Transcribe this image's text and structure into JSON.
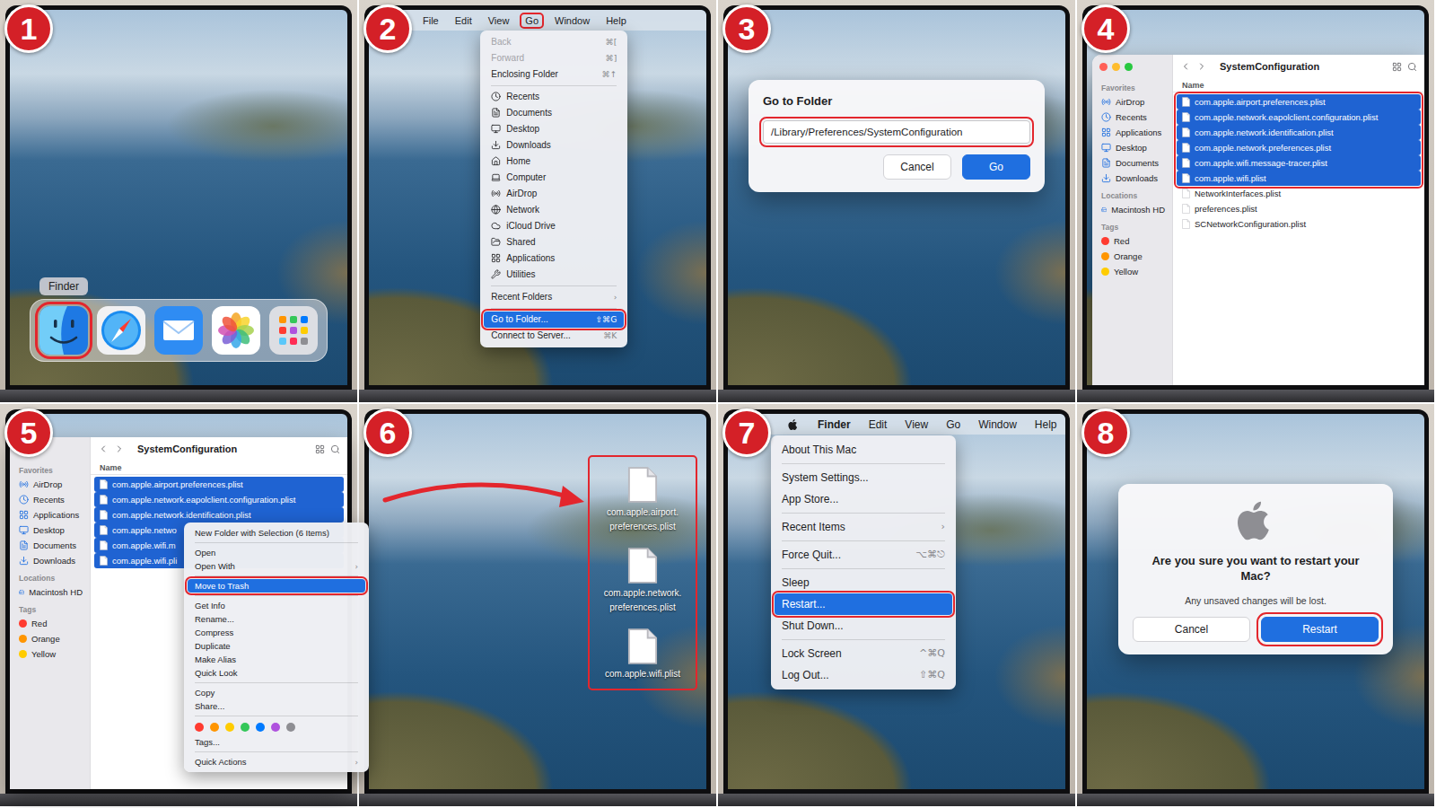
{
  "panels": [
    {
      "number": "1",
      "kind": "dock",
      "tooltip": "Finder",
      "dock_items": [
        {
          "kind": "finder",
          "selected": true
        },
        {
          "kind": "safari",
          "selected": false
        },
        {
          "kind": "mail",
          "selected": false
        },
        {
          "kind": "photos",
          "selected": false
        },
        {
          "kind": "launchpad",
          "selected": false
        }
      ]
    },
    {
      "number": "2",
      "kind": "go-menu",
      "menu_bar": [
        {
          "label": "File",
          "bold": false,
          "selected": false
        },
        {
          "label": "Edit",
          "bold": false,
          "selected": false
        },
        {
          "label": "View",
          "bold": false,
          "selected": false
        },
        {
          "label": "Go",
          "bold": false,
          "selected": true
        },
        {
          "label": "Window",
          "bold": false,
          "selected": false
        },
        {
          "label": "Help",
          "bold": false,
          "selected": false
        }
      ],
      "menu": [
        {
          "kind": "item",
          "label": "Back",
          "shortcut": "⌘[",
          "disabled": true,
          "selected": false
        },
        {
          "kind": "item",
          "label": "Forward",
          "shortcut": "⌘]",
          "disabled": true,
          "selected": false
        },
        {
          "kind": "item",
          "label": "Enclosing Folder",
          "shortcut": "⌘↑",
          "disabled": false,
          "selected": false
        },
        {
          "kind": "separator"
        },
        {
          "kind": "place",
          "label": "Recents",
          "disabled": false,
          "selected": false
        },
        {
          "kind": "place",
          "label": "Documents",
          "disabled": false,
          "selected": false
        },
        {
          "kind": "place",
          "label": "Desktop",
          "disabled": false,
          "selected": false
        },
        {
          "kind": "place",
          "label": "Downloads",
          "disabled": false,
          "selected": false
        },
        {
          "kind": "place",
          "label": "Home",
          "disabled": false,
          "selected": false
        },
        {
          "kind": "place",
          "label": "Computer",
          "disabled": false,
          "selected": false
        },
        {
          "kind": "place",
          "label": "AirDrop",
          "disabled": false,
          "selected": false
        },
        {
          "kind": "place",
          "label": "Network",
          "disabled": false,
          "selected": false
        },
        {
          "kind": "place",
          "label": "iCloud Drive",
          "disabled": false,
          "selected": false
        },
        {
          "kind": "place",
          "label": "Shared",
          "disabled": false,
          "selected": false
        },
        {
          "kind": "place",
          "label": "Applications",
          "disabled": false,
          "selected": false
        },
        {
          "kind": "place",
          "label": "Utilities",
          "disabled": false,
          "selected": false
        },
        {
          "kind": "separator"
        },
        {
          "kind": "submenu",
          "label": "Recent Folders",
          "arrow": "›",
          "disabled": false,
          "selected": false
        },
        {
          "kind": "separator"
        },
        {
          "kind": "item",
          "label": "Go to Folder...",
          "shortcut": "⇧⌘G",
          "disabled": false,
          "selected": true
        },
        {
          "kind": "item",
          "label": "Connect to Server...",
          "shortcut": "⌘K",
          "disabled": false,
          "selected": false
        }
      ]
    },
    {
      "number": "3",
      "kind": "go-dialog",
      "dialog": {
        "title": "Go to Folder",
        "path": "/Library/Preferences/SystemConfiguration",
        "field_highlighted": true,
        "buttons": [
          {
            "label": "Cancel",
            "selected": false,
            "highlighted": false
          },
          {
            "label": "Go",
            "selected": true,
            "highlighted": false
          }
        ]
      }
    },
    {
      "number": "4",
      "kind": "finder",
      "window": {
        "title": "SystemConfiguration",
        "show_controls": true,
        "selection_boxed": true,
        "column": "Name",
        "sidebar": [
          {
            "heading": "Favorites",
            "items": [
              {
                "label": "AirDrop",
                "kind": "place"
              },
              {
                "label": "Recents",
                "kind": "place"
              },
              {
                "label": "Applications",
                "kind": "place"
              },
              {
                "label": "Desktop",
                "kind": "place"
              },
              {
                "label": "Documents",
                "kind": "place"
              },
              {
                "label": "Downloads",
                "kind": "place"
              }
            ]
          },
          {
            "heading": "Locations",
            "items": [
              {
                "label": "Macintosh HD",
                "kind": "place"
              }
            ]
          },
          {
            "heading": "Tags",
            "items": [
              {
                "label": "Red",
                "kind": "tag",
                "color": "#ff3b30"
              },
              {
                "label": "Orange",
                "kind": "tag",
                "color": "#ff9500"
              },
              {
                "label": "Yellow",
                "kind": "tag",
                "color": "#ffcc00"
              }
            ]
          }
        ],
        "files": [
          {
            "name": "com.apple.airport.preferences.plist",
            "selected": true
          },
          {
            "name": "com.apple.network.eapolclient.configuration.plist",
            "selected": true
          },
          {
            "name": "com.apple.network.identification.plist",
            "selected": true
          },
          {
            "name": "com.apple.network.preferences.plist",
            "selected": true
          },
          {
            "name": "com.apple.wifi.message-tracer.plist",
            "selected": true
          },
          {
            "name": "com.apple.wifi.plist",
            "selected": true
          },
          {
            "name": "NetworkInterfaces.plist",
            "selected": false
          },
          {
            "name": "preferences.plist",
            "selected": false
          },
          {
            "name": "SCNetworkConfiguration.plist",
            "selected": false
          }
        ]
      }
    },
    {
      "number": "5",
      "kind": "finder-menu",
      "window": {
        "title": "SystemConfiguration",
        "show_controls": false,
        "selection_boxed": false,
        "column": "Name",
        "sidebar": [
          {
            "heading": "Favorites",
            "items": [
              {
                "label": "AirDrop",
                "kind": "place"
              },
              {
                "label": "Recents",
                "kind": "place"
              },
              {
                "label": "Applications",
                "kind": "place"
              },
              {
                "label": "Desktop",
                "kind": "place"
              },
              {
                "label": "Documents",
                "kind": "place"
              },
              {
                "label": "Downloads",
                "kind": "place"
              }
            ]
          },
          {
            "heading": "Locations",
            "items": [
              {
                "label": "Macintosh HD",
                "kind": "place"
              }
            ]
          },
          {
            "heading": "Tags",
            "items": [
              {
                "label": "Red",
                "kind": "tag",
                "color": "#ff3b30"
              },
              {
                "label": "Orange",
                "kind": "tag",
                "color": "#ff9500"
              },
              {
                "label": "Yellow",
                "kind": "tag",
                "color": "#ffcc00"
              }
            ]
          }
        ],
        "files": [
          {
            "name": "com.apple.airport.preferences.plist",
            "selected": true
          },
          {
            "name": "com.apple.network.eapolclient.configuration.plist",
            "selected": true
          },
          {
            "name": "com.apple.network.identification.plist",
            "selected": true
          },
          {
            "name": "com.apple.netwo",
            "selected": true
          },
          {
            "name": "com.apple.wifi.m",
            "selected": true
          },
          {
            "name": "com.apple.wifi.pli",
            "selected": true
          }
        ]
      },
      "context_menu": [
        {
          "kind": "item",
          "label": "New Folder with Selection (6 Items)",
          "disabled": false,
          "selected": false
        },
        {
          "kind": "separator"
        },
        {
          "kind": "item",
          "label": "Open",
          "disabled": false,
          "selected": false
        },
        {
          "kind": "submenu",
          "label": "Open With",
          "arrow": "›",
          "disabled": false,
          "selected": false
        },
        {
          "kind": "separator"
        },
        {
          "kind": "item",
          "label": "Move to Trash",
          "disabled": false,
          "selected": true
        },
        {
          "kind": "separator"
        },
        {
          "kind": "item",
          "label": "Get Info",
          "disabled": false,
          "selected": false
        },
        {
          "kind": "item",
          "label": "Rename...",
          "disabled": false,
          "selected": false
        },
        {
          "kind": "item",
          "label": "Compress",
          "disabled": false,
          "selected": false
        },
        {
          "kind": "item",
          "label": "Duplicate",
          "disabled": false,
          "selected": false
        },
        {
          "kind": "item",
          "label": "Make Alias",
          "disabled": false,
          "selected": false
        },
        {
          "kind": "item",
          "label": "Quick Look",
          "disabled": false,
          "selected": false
        },
        {
          "kind": "separator"
        },
        {
          "kind": "item",
          "label": "Copy",
          "disabled": false,
          "selected": false
        },
        {
          "kind": "item",
          "label": "Share...",
          "disabled": false,
          "selected": false
        },
        {
          "kind": "separator"
        },
        {
          "kind": "colors",
          "colors": [
            "#ff3b30",
            "#ff9500",
            "#ffcc00",
            "#34c759",
            "#007aff",
            "#af52de",
            "#8e8e93"
          ]
        },
        {
          "kind": "item",
          "label": "Tags...",
          "disabled": false,
          "selected": false
        },
        {
          "kind": "separator"
        },
        {
          "kind": "submenu",
          "label": "Quick Actions",
          "arrow": "›",
          "disabled": false,
          "selected": false
        }
      ]
    },
    {
      "number": "6",
      "kind": "desktop-files",
      "highlighted": true,
      "files": [
        {
          "lines": [
            "com.apple.airport.",
            "preferences.plist"
          ]
        },
        {
          "lines": [
            "com.apple.network.",
            "preferences.plist"
          ]
        },
        {
          "lines": [
            "com.apple.wifi.plist"
          ]
        }
      ]
    },
    {
      "number": "7",
      "kind": "apple-menu",
      "menu_bar": [
        {
          "label": "Finder",
          "bold": true,
          "selected": false
        },
        {
          "label": "Edit",
          "bold": false,
          "selected": false
        },
        {
          "label": "View",
          "bold": false,
          "selected": false
        },
        {
          "label": "Go",
          "bold": false,
          "selected": false
        },
        {
          "label": "Window",
          "bold": false,
          "selected": false
        },
        {
          "label": "Help",
          "bold": false,
          "selected": false
        }
      ],
      "menu": [
        {
          "kind": "item",
          "label": "About This Mac",
          "shortcut": "",
          "disabled": false,
          "selected": false
        },
        {
          "kind": "separator"
        },
        {
          "kind": "item",
          "label": "System Settings...",
          "shortcut": "",
          "disabled": false,
          "selected": false
        },
        {
          "kind": "item",
          "label": "App Store...",
          "shortcut": "",
          "disabled": false,
          "selected": false
        },
        {
          "kind": "separator"
        },
        {
          "kind": "submenu",
          "label": "Recent Items",
          "arrow": "›",
          "disabled": false,
          "selected": false
        },
        {
          "kind": "separator"
        },
        {
          "kind": "item",
          "label": "Force Quit...",
          "shortcut": "⌥⌘⎋",
          "disabled": false,
          "selected": false
        },
        {
          "kind": "separator"
        },
        {
          "kind": "item",
          "label": "Sleep",
          "shortcut": "",
          "disabled": false,
          "selected": false
        },
        {
          "kind": "item",
          "label": "Restart...",
          "shortcut": "",
          "disabled": false,
          "selected": true
        },
        {
          "kind": "item",
          "label": "Shut Down...",
          "shortcut": "",
          "disabled": false,
          "selected": false
        },
        {
          "kind": "separator"
        },
        {
          "kind": "item",
          "label": "Lock Screen",
          "shortcut": "^⌘Q",
          "disabled": false,
          "selected": false
        },
        {
          "kind": "item",
          "label": "Log Out...",
          "shortcut": "⇧⌘Q",
          "disabled": false,
          "selected": false
        }
      ]
    },
    {
      "number": "8",
      "kind": "restart-dialog",
      "dialog": {
        "title": "Are you sure you want to restart your Mac?",
        "message": "Any unsaved changes will be lost.",
        "buttons": [
          {
            "label": "Cancel",
            "selected": false,
            "highlighted": false
          },
          {
            "label": "Restart",
            "selected": true,
            "highlighted": true
          }
        ]
      }
    }
  ]
}
